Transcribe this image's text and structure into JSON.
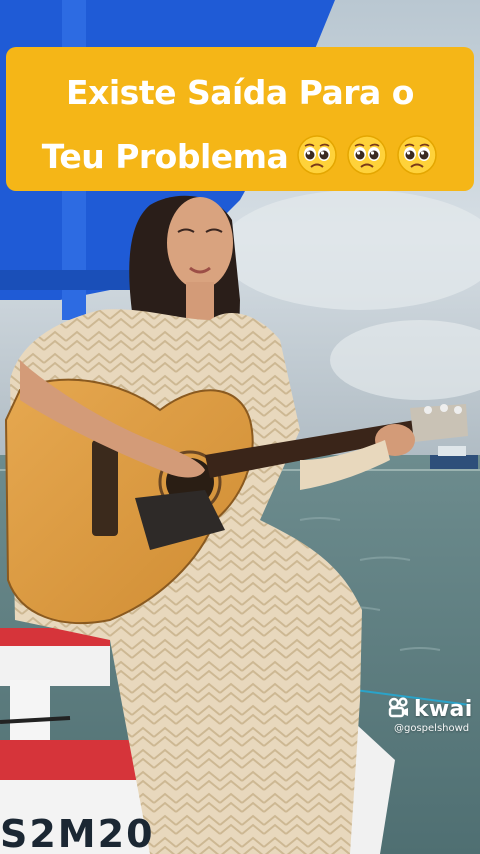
{
  "caption": {
    "line1": "Existe Saída Para o",
    "line2": "Teu Problema",
    "emoji_icons": [
      "pleading-face-icon",
      "pleading-face-icon",
      "pleading-face-icon"
    ]
  },
  "watermark": {
    "brand": "kwai",
    "handle": "@gospelshowd",
    "icon": "kwai-logo-icon"
  },
  "boat_hull_text": "S2M20",
  "colors": {
    "caption_background": "#f5b617",
    "caption_text": "#ffffff",
    "awning_blue": "#1f5bd6",
    "boat_red": "#d6343a"
  }
}
